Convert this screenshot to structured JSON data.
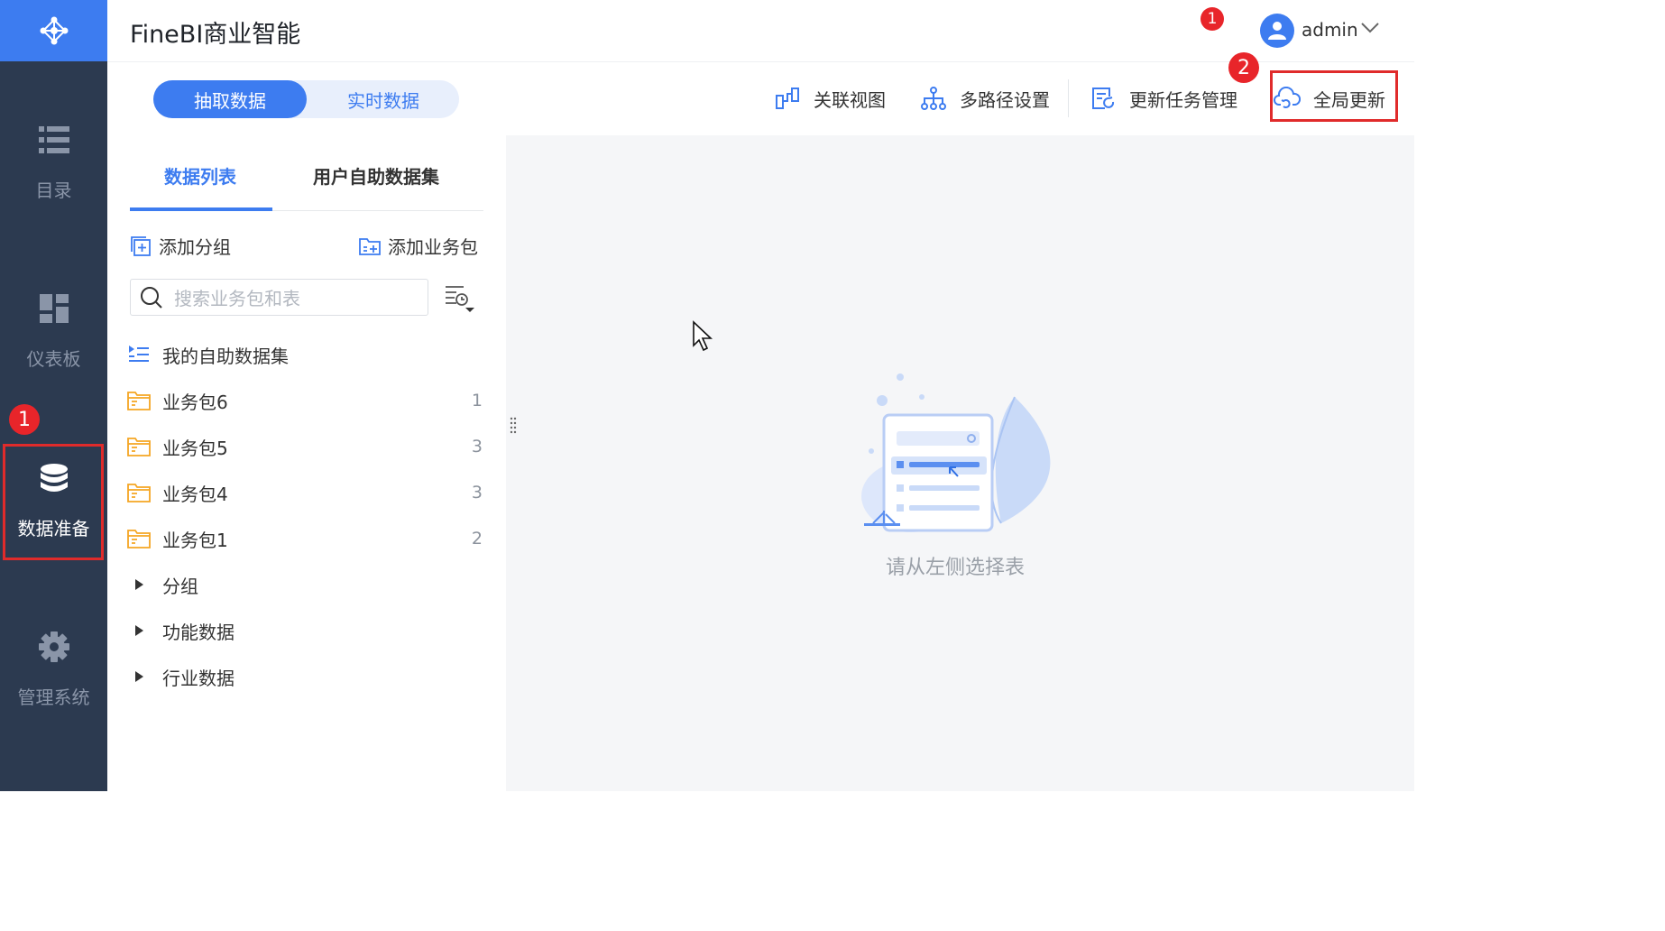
{
  "app": {
    "title": "FineBI商业智能"
  },
  "nav": {
    "items": [
      {
        "label": "目录",
        "icon": "list-icon"
      },
      {
        "label": "仪表板",
        "icon": "dashboard-icon"
      },
      {
        "label": "数据准备",
        "icon": "database-icon",
        "active": true
      },
      {
        "label": "管理系统",
        "icon": "gear-icon"
      }
    ],
    "callout": "1"
  },
  "header": {
    "notifications": "1",
    "user": "admin",
    "callout": "2"
  },
  "mode_switch": {
    "extract": "抽取数据",
    "realtime": "实时数据",
    "selected": "抽取数据"
  },
  "toolbar": {
    "relation_view": "关联视图",
    "multipath": "多路径设置",
    "update_tasks": "更新任务管理",
    "global_update": "全局更新"
  },
  "panel": {
    "tabs": [
      "数据列表",
      "用户自助数据集"
    ],
    "active_tab": "数据列表",
    "add_group": "添加分组",
    "add_package": "添加业务包",
    "search_placeholder": "搜索业务包和表",
    "items": [
      {
        "type": "self-service",
        "label": "我的自助数据集",
        "count": ""
      },
      {
        "type": "package",
        "label": "业务包6",
        "count": "1"
      },
      {
        "type": "package",
        "label": "业务包5",
        "count": "3"
      },
      {
        "type": "package",
        "label": "业务包4",
        "count": "3"
      },
      {
        "type": "package",
        "label": "业务包1",
        "count": "2"
      },
      {
        "type": "group",
        "label": "分组",
        "count": ""
      },
      {
        "type": "group",
        "label": "功能数据",
        "count": ""
      },
      {
        "type": "group",
        "label": "行业数据",
        "count": ""
      }
    ]
  },
  "empty_state": {
    "message": "请从左侧选择表"
  },
  "colors": {
    "nav_bg": "#2c3a50",
    "accent": "#3d7cf0",
    "highlight_border": "#e02b2b",
    "folder": "#f5a623"
  }
}
